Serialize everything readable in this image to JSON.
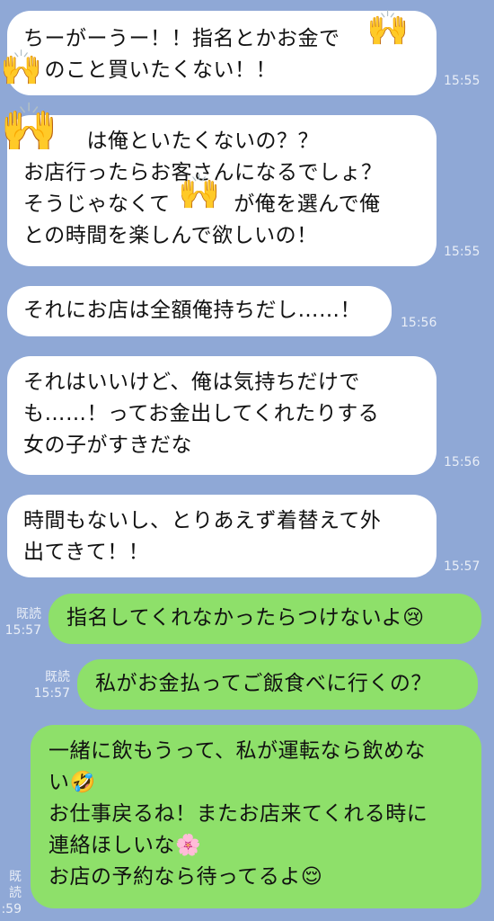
{
  "messages": [
    {
      "dir": "in",
      "text": "ちーがーうー！！指名とかお金で　　\n　のこと買いたくない！！",
      "time": "15:55"
    },
    {
      "dir": "in",
      "text": "　　　は俺といたくないの？？\nお店行ったらお客さんになるでしょ？\nそうじゃなくて　　　が俺を選んで俺\nとの時間を楽しんで欲しいの！",
      "time": "15:55"
    },
    {
      "dir": "in",
      "text": "それにお店は全額俺持ちだし……！",
      "time": "15:56"
    },
    {
      "dir": "in",
      "text": "それはいいけど、俺は気持ちだけで\nも……！ってお金出してくれたりする\n女の子がすきだな",
      "time": "15:56"
    },
    {
      "dir": "in",
      "text": "時間もないし、とりあえず着替えて外\n出てきて！！",
      "time": "15:57"
    },
    {
      "dir": "out",
      "text": "指名してくれなかったらつけないよ😢",
      "read": "既読",
      "time": "15:57"
    },
    {
      "dir": "out",
      "text": "私がお金払ってご飯食べに行くの？",
      "read": "既読",
      "time": "15:57"
    },
    {
      "dir": "out",
      "text": "一緒に飲もうって、私が運転なら飲めな\nい🤣\nお仕事戻るね！またお店来てくれる時に\n連絡ほしいな🌸\nお店の予約なら待ってるよ😌",
      "read": "既読",
      "time": ":59"
    }
  ],
  "redaction_icon": "raised-hands-emoji"
}
